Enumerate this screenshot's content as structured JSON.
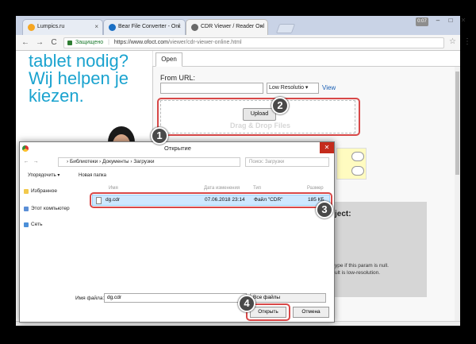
{
  "browser": {
    "tabs": [
      {
        "label": "Lumpics.ru",
        "color": "#f5a623"
      },
      {
        "label": "Bear File Converter - Onl",
        "color": "#1a6fc4"
      },
      {
        "label": "CDR Viewer / Reader Onl",
        "color": "#6a6a6a"
      }
    ],
    "profile_label": "0:07",
    "minimize": "–",
    "maximize": "□",
    "close": "✕",
    "tab_close": "×",
    "back": "←",
    "forward": "→",
    "reload": "C",
    "secure_label": "Защищено",
    "separator": "|",
    "url_host": "https://www.ofoct.com",
    "url_path": "/viewer/cdr-viewer-online.html",
    "star": "☆",
    "menu": "⋮"
  },
  "page": {
    "promo_text_1": "tablet nodig?",
    "promo_text_2": "Wij helpen je",
    "promo_text_3": "kiezen.",
    "tab_open": "Open",
    "from_url_label": "From URL:",
    "resolution_select": "Low Resolutio ▾",
    "view_link": "View",
    "upload_button": "Upload",
    "drag_text": "Drag & Drop Files",
    "object_title": "ject:",
    "note_line_1": "ype if this param is null.",
    "note_line_2": "ult is low-resolution."
  },
  "dialog": {
    "title": "Открытие",
    "close": "✕",
    "path": [
      "Библиотеки",
      "Документы",
      "Загрузки"
    ],
    "path_sep": "›",
    "search_placeholder": "Поиск: Загрузки",
    "organize": "Упорядочить ▾",
    "new_folder": "Новая папка",
    "nav_items": [
      {
        "label": "Избранное",
        "color": "#f2c94c"
      },
      {
        "label": "Этот компьютер",
        "color": "#5b8fd6"
      },
      {
        "label": "Сеть",
        "color": "#4b8fd8"
      }
    ],
    "columns": {
      "name": "Имя",
      "date": "Дата изменения",
      "type": "Тип",
      "size": "Размер"
    },
    "file": {
      "name": "dg.cdr",
      "date": "07.06.2018 23:14",
      "type": "Файл \"CDR\"",
      "size": "185 КБ"
    },
    "filename_label": "Имя файла:",
    "filename_value": "dg.cdr",
    "filter": "Все файлы",
    "open_button": "Открыть",
    "cancel_button": "Отмена"
  },
  "steps": [
    "1",
    "2",
    "3",
    "4"
  ],
  "colors": {
    "highlight": "#d84848",
    "accent": "#1aa3cf"
  }
}
